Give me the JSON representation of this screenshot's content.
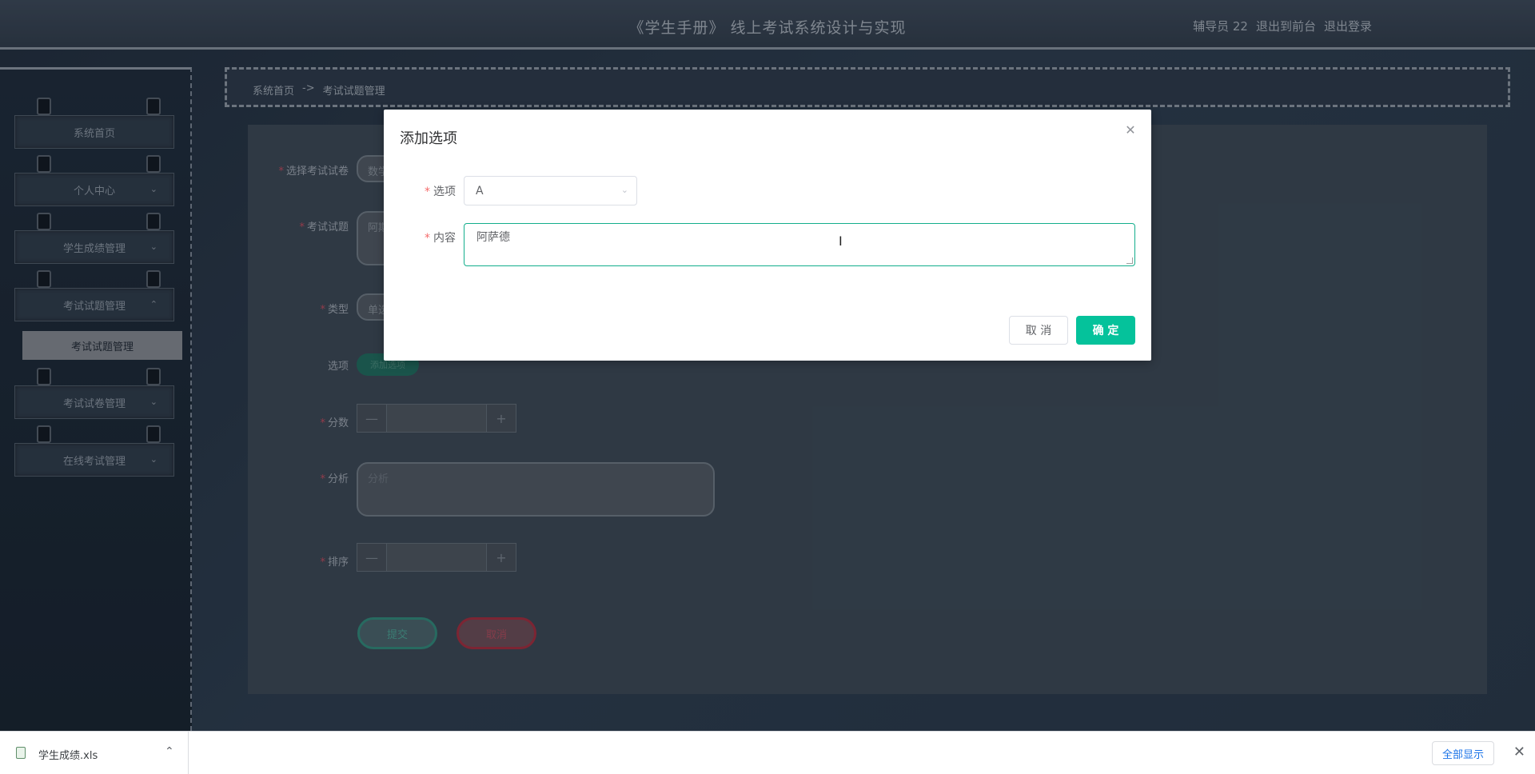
{
  "header": {
    "title": "《学生手册》 线上考试系统设计与实现",
    "user": "辅导员 22",
    "to_front": "退出到前台",
    "logout": "退出登录"
  },
  "sidebar": {
    "items": [
      {
        "label": "系统首页"
      },
      {
        "label": "个人中心"
      },
      {
        "label": "学生成绩管理"
      },
      {
        "label": "考试试题管理"
      },
      {
        "label": "考试试卷管理"
      },
      {
        "label": "在线考试管理"
      }
    ],
    "active_sub": "考试试题管理"
  },
  "breadcrumb": {
    "home": "系统首页",
    "sep": "->",
    "current": "考试试题管理"
  },
  "form": {
    "paper_label": "选择考试试卷",
    "paper_value": "数学",
    "question_label": "考试试题",
    "question_value": "阿期",
    "type_label": "类型",
    "type_value": "单选",
    "options_label": "选项",
    "add_option": "添加选项",
    "score_label": "分数",
    "analysis_label": "分析",
    "analysis_placeholder": "分析",
    "order_label": "排序",
    "submit": "提交",
    "cancel": "取消"
  },
  "dialog": {
    "title": "添加选项",
    "option_label": "选项",
    "option_value": "A",
    "content_label": "内容",
    "content_value": "阿萨德",
    "cancel": "取 消",
    "confirm": "确 定"
  },
  "download_bar": {
    "filename": "学生成绩.xls",
    "show_all": "全部显示"
  },
  "colors": {
    "accent": "#05c29b",
    "danger": "#a42a3b",
    "required": "#f56c6c"
  }
}
